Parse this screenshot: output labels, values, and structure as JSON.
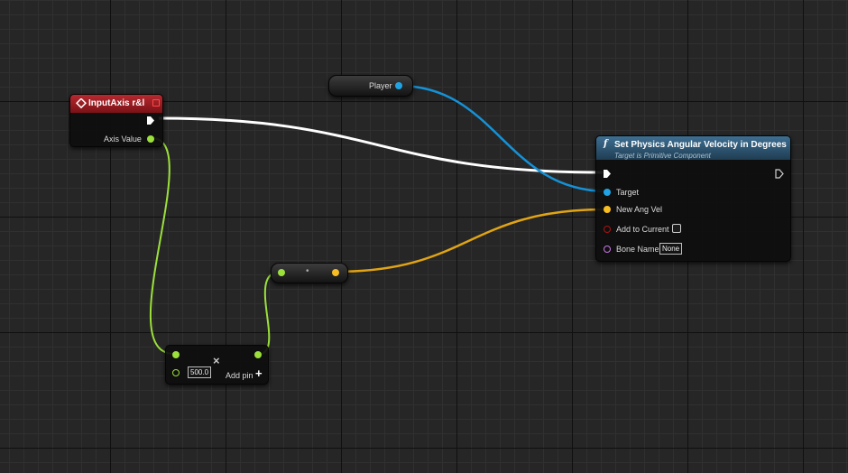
{
  "input_axis_node": {
    "title": "InputAxis r&l",
    "output_label": "Axis Value",
    "colors": {
      "header": "#a31f24"
    }
  },
  "player_node": {
    "label": "Player"
  },
  "function_node": {
    "icon": "f",
    "title": "Set Physics Angular Velocity in Degrees",
    "subtitle": "Target is Primitive Component",
    "pins": {
      "target": "Target",
      "new_ang_vel": "New Ang Vel",
      "add_to_current": "Add to Current",
      "bone_name": "Bone Name"
    },
    "bone_name_value": "None",
    "add_to_current_checked": false
  },
  "multiply_node": {
    "value": "500.0",
    "add_pin_label": "Add pin",
    "add_pin_icon": "+",
    "remove_icon": "×"
  },
  "make_vector_node": {
    "dot_icon": "•"
  },
  "colors": {
    "exec": "#ffffff",
    "object": "#1fa3e4",
    "float": "#9be03b",
    "vector": "#f7bd22",
    "bool": "#8e0f0f",
    "name": "#c979e8"
  }
}
